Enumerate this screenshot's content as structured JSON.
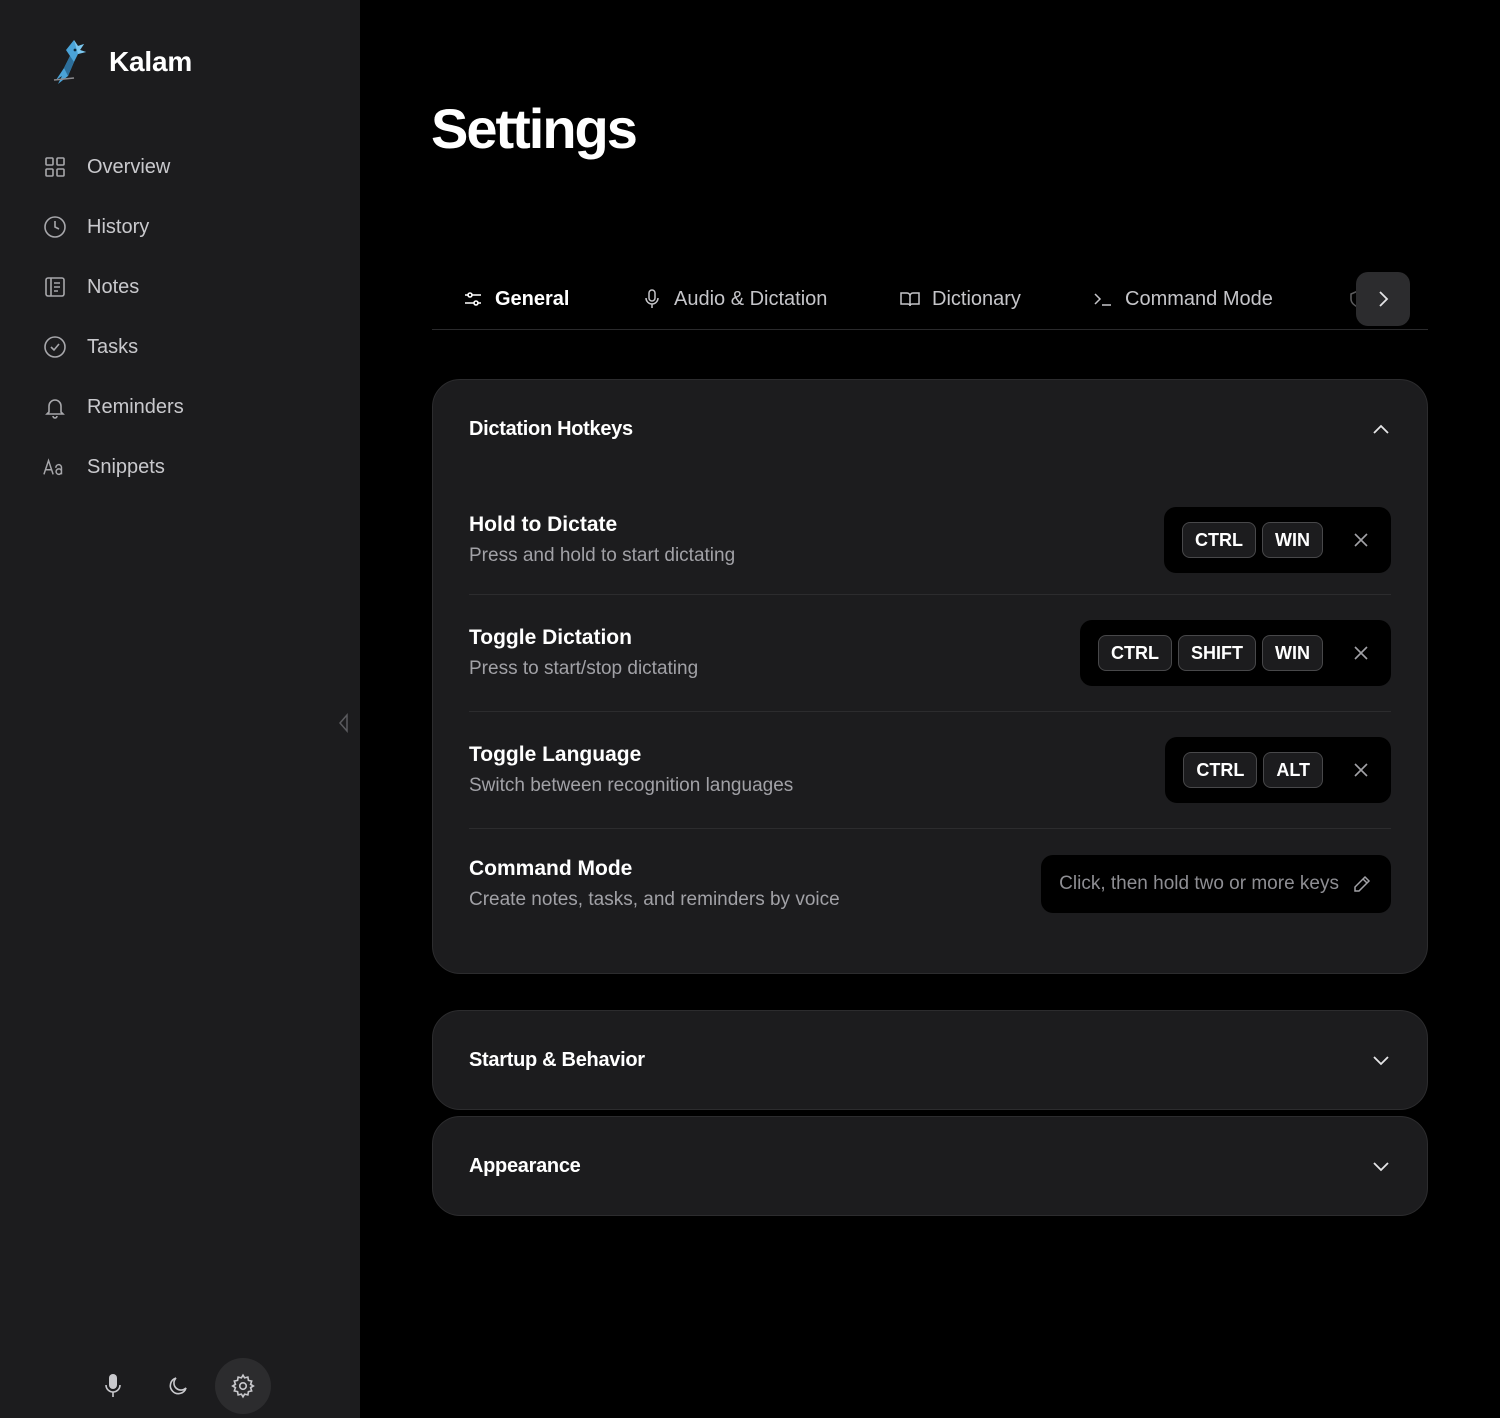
{
  "app": {
    "name": "Kalam"
  },
  "sidebar": {
    "items": [
      {
        "label": "Overview",
        "icon": "grid-icon"
      },
      {
        "label": "History",
        "icon": "clock-icon"
      },
      {
        "label": "Notes",
        "icon": "notebook-icon"
      },
      {
        "label": "Tasks",
        "icon": "check-circle-icon"
      },
      {
        "label": "Reminders",
        "icon": "bell-icon"
      },
      {
        "label": "Snippets",
        "icon": "text-case-icon"
      }
    ],
    "collapse_icon": "triangle-left-icon",
    "footer": {
      "buttons": [
        {
          "icon": "microphone-icon"
        },
        {
          "icon": "moon-icon"
        },
        {
          "icon": "gear-icon",
          "active": true
        }
      ]
    }
  },
  "page": {
    "title": "Settings"
  },
  "tabs": [
    {
      "label": "General",
      "icon": "sliders-icon",
      "active": true
    },
    {
      "label": "Audio & Dictation",
      "icon": "microphone-icon"
    },
    {
      "label": "Dictionary",
      "icon": "book-open-icon"
    },
    {
      "label": "Command Mode",
      "icon": "terminal-icon"
    },
    {
      "label": "",
      "icon": "shield-icon"
    }
  ],
  "sections": {
    "dictation_hotkeys": {
      "title": "Dictation Hotkeys",
      "expanded": true,
      "rows": [
        {
          "title": "Hold to Dictate",
          "description": "Press and hold to start dictating",
          "keys": [
            "CTRL",
            "WIN"
          ]
        },
        {
          "title": "Toggle Dictation",
          "description": "Press to start/stop dictating",
          "keys": [
            "CTRL",
            "SHIFT",
            "WIN"
          ]
        },
        {
          "title": "Toggle Language",
          "description": "Switch between recognition languages",
          "keys": [
            "CTRL",
            "ALT"
          ]
        },
        {
          "title": "Command Mode",
          "description": "Create notes, tasks, and reminders by voice",
          "placeholder": "Click, then hold two or more keys"
        }
      ]
    },
    "startup": {
      "title": "Startup & Behavior",
      "expanded": false
    },
    "appearance": {
      "title": "Appearance",
      "expanded": false
    }
  },
  "colors": {
    "background": "#000000",
    "sidebar": "#1c1c1e",
    "card": "#1c1c1e",
    "text_secondary": "#a1a1a6"
  }
}
